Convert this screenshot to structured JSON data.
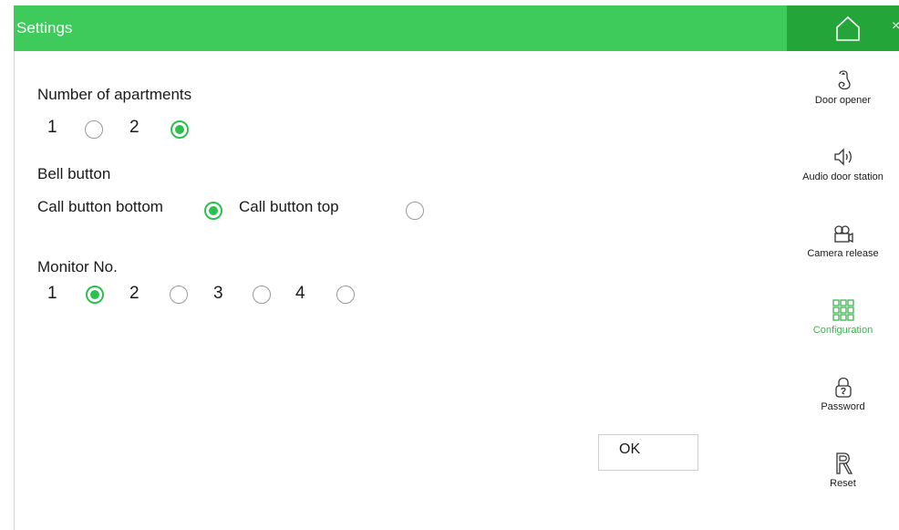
{
  "header": {
    "title": "Settings"
  },
  "sidebar": {
    "close_glyph": "×",
    "items": [
      {
        "label": "Door opener",
        "icon": "door-opener-icon",
        "active": false
      },
      {
        "label": "Audio door station",
        "icon": "speaker-icon",
        "active": false
      },
      {
        "label": "Camera release",
        "icon": "camera-icon",
        "active": false
      },
      {
        "label": "Configuration",
        "icon": "grid-icon",
        "active": true
      },
      {
        "label": "Password",
        "icon": "lock-icon",
        "active": false
      },
      {
        "label": "Reset",
        "icon": "reset-icon",
        "active": false
      }
    ]
  },
  "settings": {
    "apartments": {
      "label": "Number of apartments",
      "options": [
        "1",
        "2"
      ],
      "selected": "2"
    },
    "bell": {
      "label": "Bell button",
      "options": [
        "Call button bottom",
        "Call button top"
      ],
      "selected": "Call button bottom"
    },
    "monitor": {
      "label": "Monitor No.",
      "options": [
        "1",
        "2",
        "3",
        "4"
      ],
      "selected": "1"
    }
  },
  "actions": {
    "ok_label": "OK"
  },
  "colors": {
    "header": "#3fcb5b",
    "home_bar": "#23a539",
    "radio_checked": "#2cc14f",
    "active_nav": "#3fb352"
  }
}
